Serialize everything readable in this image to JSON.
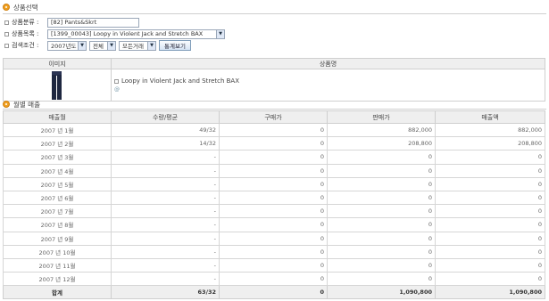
{
  "section1": {
    "title": "상품선택"
  },
  "filters": {
    "category_label": "상품분류 :",
    "category_value": "[82] Pants&Skrt",
    "product_label": "상품목록 :",
    "product_value": "[1399_00043] Loopy in Violent Jack and Stretch BAX",
    "condition_label": "검색조건 :",
    "year_value": "2007년도",
    "scope_value": "전체",
    "deal_value": "모든거래",
    "view_button": "통계보기"
  },
  "product_table": {
    "headers": [
      "이미지",
      "상품명"
    ],
    "product_name": "Loopy in Violent Jack and Stretch BAX",
    "mini_icon": "@"
  },
  "section2": {
    "title": "월별 매출"
  },
  "sales": {
    "headers": [
      "매출월",
      "수량/평균",
      "구매가",
      "판매가",
      "매출액"
    ],
    "rows": [
      [
        "2007 년 1월",
        "49/32",
        "0",
        "882,000",
        "882,000"
      ],
      [
        "2007 년 2월",
        "14/32",
        "0",
        "208,800",
        "208,800"
      ],
      [
        "2007 년 3월",
        "-",
        "0",
        "0",
        "0"
      ],
      [
        "2007 년 4월",
        "-",
        "0",
        "0",
        "0"
      ],
      [
        "2007 년 5월",
        "-",
        "0",
        "0",
        "0"
      ],
      [
        "2007 년 6월",
        "-",
        "0",
        "0",
        "0"
      ],
      [
        "2007 년 7월",
        "-",
        "0",
        "0",
        "0"
      ],
      [
        "2007 년 8월",
        "-",
        "0",
        "0",
        "0"
      ],
      [
        "2007 년 9월",
        "-",
        "0",
        "0",
        "0"
      ],
      [
        "2007 년 10월",
        "-",
        "0",
        "0",
        "0"
      ],
      [
        "2007 년 11월",
        "-",
        "0",
        "0",
        "0"
      ],
      [
        "2007 년 12월",
        "-",
        "0",
        "0",
        "0"
      ]
    ],
    "total": [
      "합계",
      "63/32",
      "0",
      "1,090,800",
      "1,090,800"
    ]
  },
  "icons": {
    "bullet": "orange-circle-bullet-icon",
    "arrow": "chevron-down-icon"
  }
}
